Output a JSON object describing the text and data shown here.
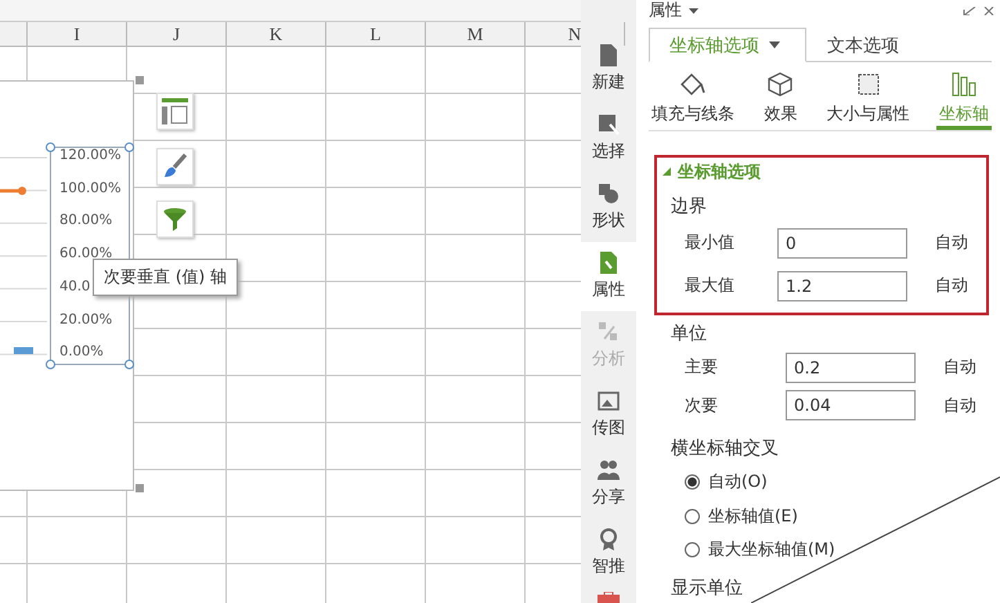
{
  "spreadsheet": {
    "columns": [
      "I",
      "J",
      "K",
      "L",
      "M",
      "N"
    ]
  },
  "chart": {
    "axis_labels": [
      "120.00%",
      "100.00%",
      "80.00%",
      "60.00%",
      "40.0",
      "20.00%",
      "0.00%"
    ],
    "tooltip": "次要垂直 (值) 轴"
  },
  "sidebar": {
    "items": [
      {
        "label": "新建",
        "selected": false,
        "disabled": false
      },
      {
        "label": "选择",
        "selected": false,
        "disabled": false
      },
      {
        "label": "形状",
        "selected": false,
        "disabled": false
      },
      {
        "label": "属性",
        "selected": true,
        "disabled": false
      },
      {
        "label": "分析",
        "selected": false,
        "disabled": true
      },
      {
        "label": "传图",
        "selected": false,
        "disabled": false
      },
      {
        "label": "分享",
        "selected": false,
        "disabled": false
      },
      {
        "label": "智推",
        "selected": false,
        "disabled": false
      }
    ]
  },
  "panel": {
    "title": "属性",
    "tabs": [
      {
        "label": "坐标轴选项",
        "selected": true
      },
      {
        "label": "文本选项",
        "selected": false
      }
    ],
    "sub_tabs": [
      {
        "label": "填充与线条",
        "selected": false
      },
      {
        "label": "效果",
        "selected": false
      },
      {
        "label": "大小与属性",
        "selected": false
      },
      {
        "label": "坐标轴",
        "selected": true
      }
    ],
    "section": {
      "title": "坐标轴选项",
      "expanded": true,
      "highlighted": true,
      "groups": [
        {
          "title": "边界",
          "fields": [
            {
              "label": "最小值",
              "value": "0",
              "button": "自动"
            },
            {
              "label": "最大值",
              "value": "1.2",
              "button": "自动"
            }
          ]
        }
      ]
    },
    "units": {
      "title": "单位",
      "fields": [
        {
          "label": "主要",
          "value": "0.2",
          "button": "自动"
        },
        {
          "label": "次要",
          "value": "0.04",
          "button": "自动"
        }
      ]
    },
    "crosses": {
      "title": "横坐标轴交叉",
      "options": [
        {
          "label": "自动(O)",
          "selected": true
        },
        {
          "label": "坐标轴值(E)",
          "selected": false
        },
        {
          "label": "最大坐标轴值(M)",
          "selected": false
        }
      ]
    },
    "next_section": "显示单位"
  }
}
